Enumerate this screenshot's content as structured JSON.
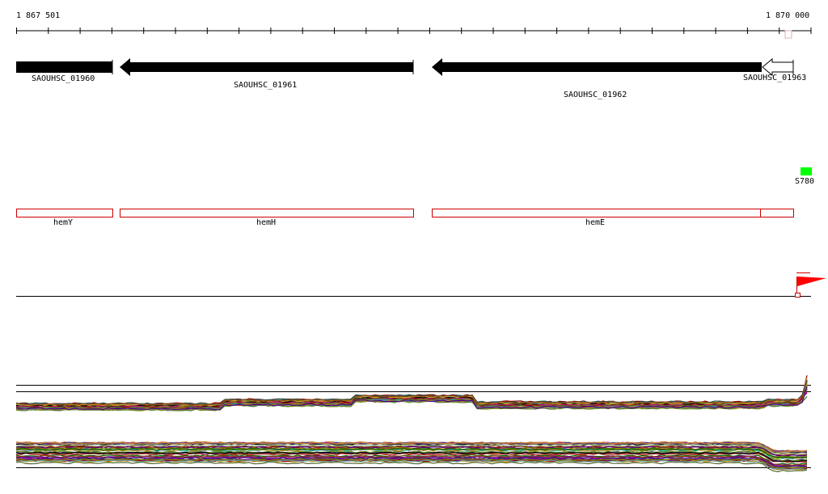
{
  "ruler": {
    "start_label": "1 867 501",
    "end_label": "1 870 000"
  },
  "genes": [
    {
      "name": "SAOUHSC_01960",
      "strand": "forward",
      "style": "filled"
    },
    {
      "name": "SAOUHSC_01961",
      "strand": "reverse",
      "style": "filled"
    },
    {
      "name": "SAOUHSC_01962",
      "strand": "reverse",
      "style": "filled"
    },
    {
      "name": "SAOUHSC_01963",
      "strand": "reverse",
      "style": "outline"
    }
  ],
  "srna": {
    "name": "S780",
    "color": "#00ff00"
  },
  "operon_genes": [
    {
      "name": "hemY"
    },
    {
      "name": "hemH"
    },
    {
      "name": "hemE"
    },
    {
      "name": ""
    }
  ],
  "colors": {
    "gene_fill": "#000000",
    "operon_border": "#cc0000",
    "tss_flag": "#ff0000",
    "srna": "#00ff00"
  },
  "expression_tracks": [
    {
      "name": "",
      "profile_count": 40
    },
    {
      "name": "",
      "profile_count": 40
    }
  ]
}
